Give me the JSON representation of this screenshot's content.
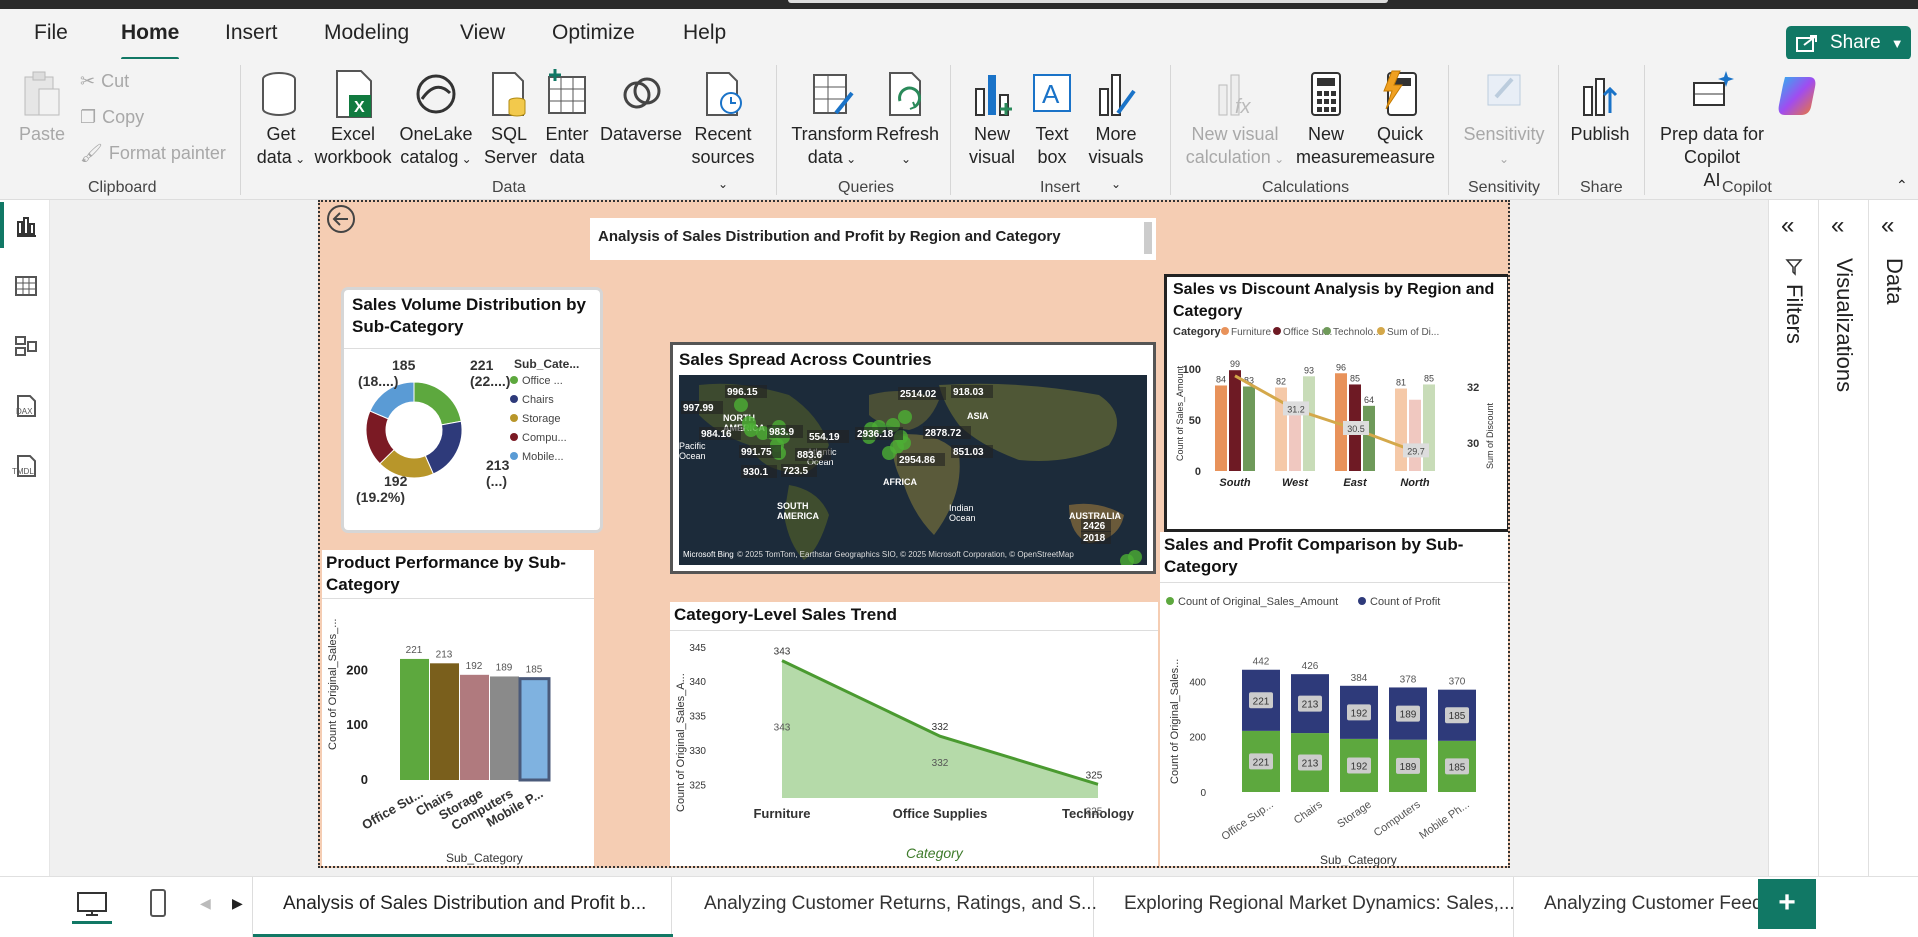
{
  "menu": {
    "file": "File",
    "home": "Home",
    "insert": "Insert",
    "modeling": "Modeling",
    "view": "View",
    "optimize": "Optimize",
    "help": "Help",
    "share": "Share"
  },
  "ribbon": {
    "paste": "Paste",
    "cut": "Cut",
    "copy": "Copy",
    "format_painter": "Format painter",
    "get_data": "Get",
    "get_data2": "data",
    "excel": "Excel",
    "excel2": "workbook",
    "onelake": "OneLake",
    "onelake2": "catalog",
    "sql": "SQL",
    "sql2": "Server",
    "enter": "Enter",
    "enter2": "data",
    "dataverse": "Dataverse",
    "recent": "Recent",
    "recent2": "sources",
    "transform": "Transform",
    "transform2": "data",
    "refresh": "Refresh",
    "new_visual": "New",
    "new_visual2": "visual",
    "text_box": "Text",
    "text_box2": "box",
    "more_visuals": "More",
    "more_visuals2": "visuals",
    "new_visual_calc": "New visual",
    "new_visual_calc2": "calculation",
    "new_measure": "New",
    "new_measure2": "measure",
    "quick_measure": "Quick",
    "quick_measure2": "measure",
    "sensitivity": "Sensitivity",
    "publish": "Publish",
    "copilot": "Prep data for Copilot",
    "copilot2": "AI",
    "groups": {
      "clipboard": "Clipboard",
      "data": "Data",
      "queries": "Queries",
      "insert": "Insert",
      "calculations": "Calculations",
      "sensitivity": "Sensitivity",
      "share": "Share",
      "copilot": "Copilot"
    }
  },
  "panes": {
    "filters": "Filters",
    "visualizations": "Visualizations",
    "data": "Data"
  },
  "report": {
    "title": "Analysis of Sales Distribution and Profit by Region and Category",
    "donut": {
      "title": "Sales Volume Distribution by Sub-Category",
      "legend_title": "Sub_Cate...",
      "legend": [
        "Office ...",
        "Chairs",
        "Storage",
        "Compu...",
        "Mobile..."
      ],
      "lbl_tl": "185",
      "lbl_tl2": "(18....)",
      "lbl_tr": "221",
      "lbl_tr2": "(22....)",
      "lbl_br": "213",
      "lbl_br2": "(...)",
      "lbl_bl": "192",
      "lbl_bl2": "(19.2%)"
    },
    "map": {
      "title": "Sales Spread Across Countries",
      "regions": [
        "NORTH AMERICA",
        "ASIA",
        "AFRICA",
        "SOUTH AMERICA",
        "AUSTRALIA",
        "Pacific Ocean",
        "Atlantic Ocean",
        "Indian Ocean"
      ],
      "labels": [
        "997.99",
        "996.15",
        "984.16",
        "983.9",
        "554.19",
        "991.75",
        "883.6",
        "930.1",
        "723.5",
        "2936.18",
        "2514.02",
        "918.03",
        "2878.72",
        "851.03",
        "2954.86",
        "2426",
        "2018"
      ],
      "credit": "© 2025 TomTom, Earthstar Geographics SIO, © 2025 Microsoft Corporation, © OpenStreetMap",
      "bing": "Microsoft Bing"
    },
    "svd": {
      "title": "Sales vs Discount Analysis by Region and Category",
      "legend_title": "Category",
      "legend": [
        "Furniture",
        "Office Su...",
        "Technolo...",
        "Sum of Di..."
      ],
      "ylabel": "Count of Sales_Amount",
      "y2label": "Sum of Discount"
    },
    "perf": {
      "title": "Product Performance by Sub-Category",
      "xlabel": "Sub_Category",
      "ylabel": "Count of Original_Sales_..."
    },
    "trend": {
      "title": "Category-Level Sales Trend",
      "xlabel": "Category",
      "ylabel": "Count of Original_Sales_A..."
    },
    "spc": {
      "title": "Sales and Profit Comparison by Sub-Category",
      "legend": [
        "Count of Original_Sales_Amount",
        "Count of Profit"
      ],
      "xlabel": "Sub_Category",
      "ylabel": "Count of Original_Sales..."
    }
  },
  "tabs": [
    "Analysis of Sales Distribution and Profit b...",
    "Analyzing Customer Returns, Ratings, and S...",
    "Exploring Regional Market Dynamics: Sales,...",
    "Analyzing Customer Feedb"
  ],
  "colors": {
    "accent": "#117865",
    "page": "#f5cdb3"
  },
  "chart_data": [
    {
      "type": "pie",
      "title": "Sales Volume Distribution by Sub-Category",
      "categories": [
        "Office Supplies",
        "Chairs",
        "Storage",
        "Computers",
        "Mobile Phones"
      ],
      "values": [
        221,
        213,
        192,
        189,
        185
      ],
      "colors": [
        "#5da83e",
        "#2e3a7a",
        "#b8962a",
        "#7b1a24",
        "#5a9bd5"
      ]
    },
    {
      "type": "bar",
      "title": "Sales vs Discount Analysis by Region and Category",
      "categories": [
        "South",
        "West",
        "East",
        "North"
      ],
      "series": [
        {
          "name": "Furniture",
          "values": [
            84,
            82,
            96,
            81
          ]
        },
        {
          "name": "Office Su...",
          "values": [
            99,
            66,
            85,
            70
          ]
        },
        {
          "name": "Technolo...",
          "values": [
            83,
            93,
            64,
            85
          ]
        }
      ],
      "line": {
        "name": "Sum of Di...",
        "values": [
          32.4,
          31.2,
          30.5,
          29.7
        ],
        "ylim": [
          29,
          33
        ]
      },
      "ylim": [
        0,
        110
      ]
    },
    {
      "type": "bar",
      "title": "Product Performance by Sub-Category",
      "categories": [
        "Office Su...",
        "Chairs",
        "Storage",
        "Computers",
        "Mobile P..."
      ],
      "values": [
        221,
        213,
        192,
        189,
        185
      ],
      "colors": [
        "#5da83e",
        "#7a5f1c",
        "#b07a7e",
        "#8a8a8a",
        "#7fb2e0"
      ],
      "ylim": [
        0,
        230
      ],
      "yticks": [
        0,
        100,
        200
      ]
    },
    {
      "type": "area",
      "title": "Category-Level Sales Trend",
      "categories": [
        "Furniture",
        "Office Supplies",
        "Technology"
      ],
      "values": [
        343,
        332,
        325
      ],
      "ylim": [
        323,
        346
      ],
      "yticks": [
        325,
        330,
        335,
        340,
        345
      ]
    },
    {
      "type": "bar",
      "title": "Sales and Profit Comparison by Sub-Category",
      "categories": [
        "Office Sup...",
        "Chairs",
        "Storage",
        "Computers",
        "Mobile Ph..."
      ],
      "series": [
        {
          "name": "Count of Original_Sales_Amount",
          "values": [
            221,
            213,
            192,
            189,
            185
          ]
        },
        {
          "name": "Count of Profit",
          "values": [
            221,
            213,
            192,
            189,
            185
          ]
        }
      ],
      "totals": [
        442,
        426,
        384,
        378,
        370
      ],
      "ylim": [
        0,
        470
      ],
      "yticks": [
        0,
        200,
        400
      ]
    }
  ]
}
